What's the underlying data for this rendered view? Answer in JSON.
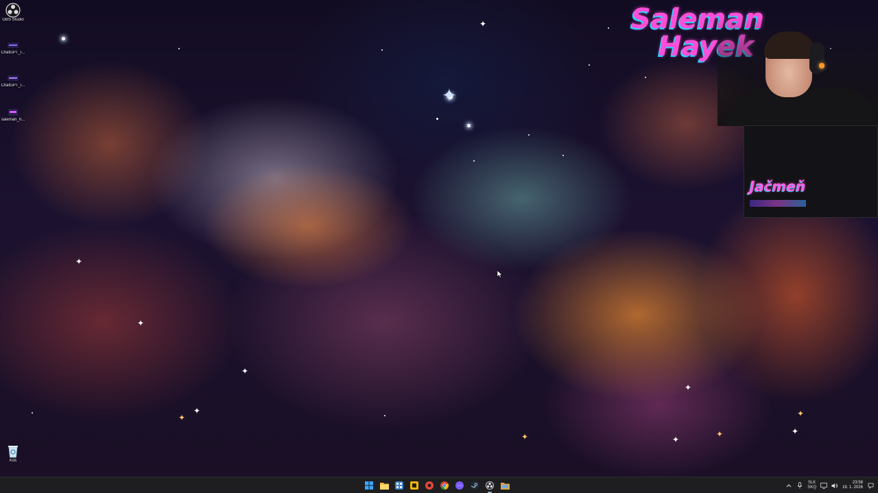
{
  "desktop": {
    "icons": [
      {
        "label": "OBS Studio",
        "icon": "obs-studio-icon"
      },
      {
        "label": "ChatGPT_I...",
        "icon": "image-file-icon"
      },
      {
        "label": "ChatGPT_I...",
        "icon": "image-file-icon"
      },
      {
        "label": "saleman_h...",
        "icon": "image-file-icon"
      },
      {
        "label": "Kôš",
        "icon": "recycle-bin-icon"
      }
    ]
  },
  "overlay": {
    "logo_line1": "Saleman",
    "logo_line2": "Hayek",
    "chat_title": "Jačmeň",
    "colors": {
      "logo_pink": "#ff4fd8",
      "logo_cyan": "#2ad0ff"
    }
  },
  "taskbar": {
    "apps": [
      {
        "name": "start",
        "icon": "windows-start-icon"
      },
      {
        "name": "file-explorer",
        "icon": "folder-icon"
      },
      {
        "name": "app-grid",
        "icon": "grid-app-icon"
      },
      {
        "name": "yellow-app",
        "icon": "yellow-square-app-icon"
      },
      {
        "name": "red-app",
        "icon": "red-circle-app-icon"
      },
      {
        "name": "chrome",
        "icon": "chrome-icon"
      },
      {
        "name": "messenger",
        "icon": "messenger-icon"
      },
      {
        "name": "steam",
        "icon": "steam-icon"
      },
      {
        "name": "obs",
        "icon": "obs-icon"
      },
      {
        "name": "folder-window",
        "icon": "open-folder-icon"
      }
    ],
    "tray": {
      "lang_line1": "SLK",
      "lang_line2": "SKQ",
      "time": "23:58",
      "date": "19. 1. 2026"
    }
  }
}
